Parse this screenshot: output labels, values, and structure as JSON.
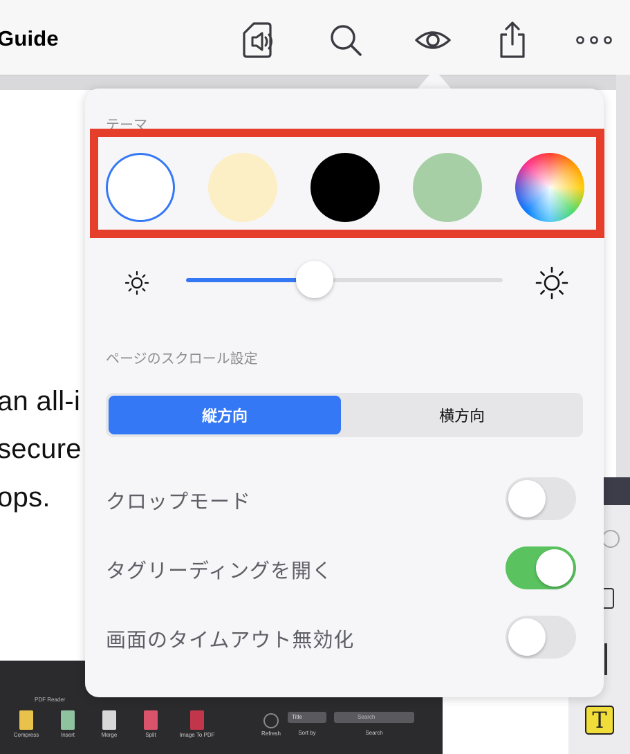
{
  "navbar": {
    "title": "Guide",
    "icons": [
      "read-aloud-icon",
      "search-icon",
      "eye-icon",
      "share-icon",
      "more-icon"
    ]
  },
  "document": {
    "lines": [
      "an all-i",
      "secure",
      "ops."
    ]
  },
  "embedded_screenshot": {
    "app_title": "PDF Reader",
    "items": [
      "Compress",
      "Insert",
      "Merge",
      "Split",
      "Image To PDF",
      "Refresh",
      "Sort by",
      "Search"
    ],
    "sort_value": "Title",
    "search_placeholder": "Search"
  },
  "side_panel": {
    "text_tool_label": "T"
  },
  "popover": {
    "theme_label": "テーマ",
    "themes": [
      {
        "name": "white",
        "color": "#ffffff",
        "selected": true
      },
      {
        "name": "sepia",
        "color": "#fcefc6",
        "selected": false
      },
      {
        "name": "black",
        "color": "#000000",
        "selected": false
      },
      {
        "name": "green",
        "color": "#a6cfa6",
        "selected": false
      },
      {
        "name": "custom",
        "color": "multicolor",
        "selected": false
      }
    ],
    "accent_color": "#3478f6",
    "highlight_color": "#e53e2a",
    "brightness": 0.4,
    "scroll_label": "ページのスクロール設定",
    "scroll_options": [
      "縦方向",
      "横方向"
    ],
    "scroll_selected": "縦方向",
    "toggles": [
      {
        "label": "クロップモード",
        "on": false
      },
      {
        "label": "タグリーディングを開く",
        "on": true
      },
      {
        "label": "画面のタイムアウト無効化",
        "on": false
      }
    ],
    "toggle_on_color": "#5ac35f"
  }
}
